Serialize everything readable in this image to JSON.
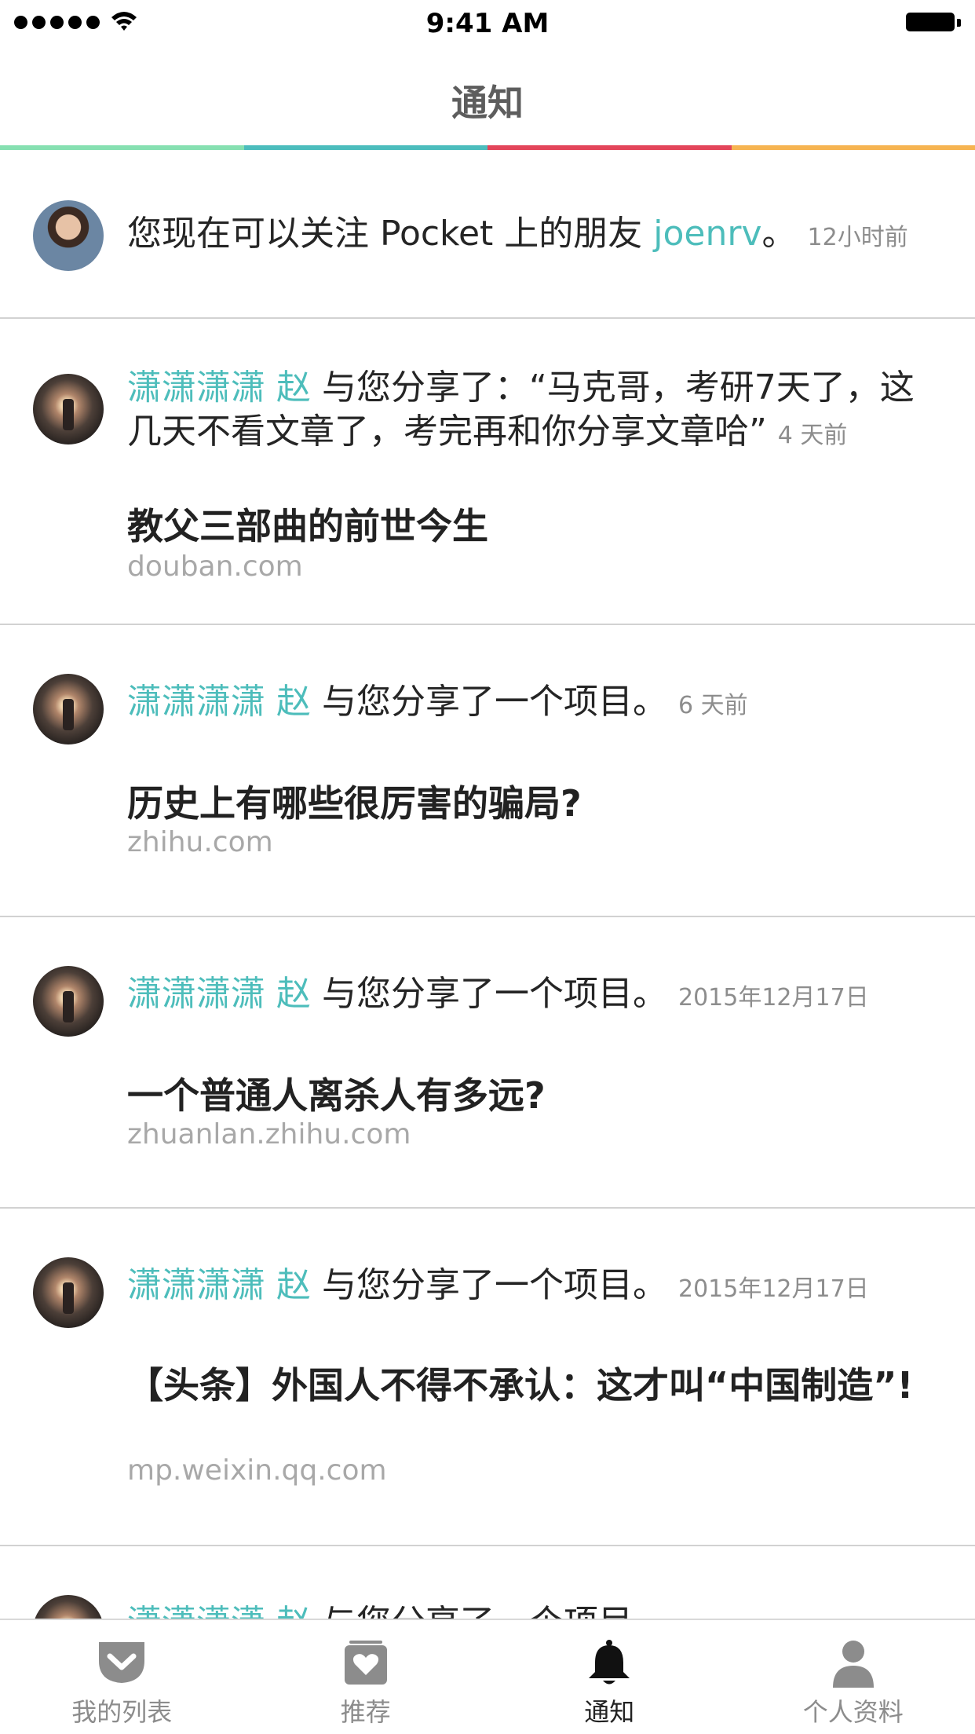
{
  "status_bar": {
    "time": "9:41 AM"
  },
  "nav": {
    "title": "通知"
  },
  "accent_colors": [
    "#86e0b1",
    "#4cbdbd",
    "#e3455a",
    "#f6b451"
  ],
  "notifications": [
    {
      "name": "",
      "prefix": "您现在可以关注 Pocket 上的朋友 ",
      "highlight": "joenrv",
      "suffix": "。",
      "time": "12小时前",
      "article_title": "",
      "article_domain": ""
    },
    {
      "name": "潇潇潇潇 赵",
      "prefix": " 与您分享了：“马克哥，考研7天了，这几天不看文章了，考完再和你分享文章哈”",
      "highlight": "",
      "suffix": "",
      "time": "4 天前",
      "article_title": "教父三部曲的前世今生",
      "article_domain": "douban.com"
    },
    {
      "name": "潇潇潇潇 赵",
      "prefix": " 与您分享了一个项目。",
      "highlight": "",
      "suffix": "",
      "time": "6 天前",
      "article_title": "历史上有哪些很厉害的骗局?",
      "article_domain": "zhihu.com"
    },
    {
      "name": "潇潇潇潇 赵",
      "prefix": " 与您分享了一个项目。",
      "highlight": "",
      "suffix": "",
      "time": "2015年12月17日",
      "article_title": "一个普通人离杀人有多远?",
      "article_domain": "zhuanlan.zhihu.com"
    },
    {
      "name": "潇潇潇潇 赵",
      "prefix": " 与您分享了一个项目。",
      "highlight": "",
      "suffix": "",
      "time": "2015年12月17日",
      "article_title": "【头条】外国人不得不承认：这才叫“中国制造”!",
      "article_domain": "mp.weixin.qq.com"
    },
    {
      "name": "潇潇潇潇 赵",
      "prefix": " 与您分享了一个项目。",
      "highlight": "",
      "suffix": "",
      "time": "",
      "article_title": "",
      "article_domain": ""
    }
  ],
  "tabs": [
    {
      "label": "我的列表",
      "icon": "pocket-icon",
      "active": false
    },
    {
      "label": "推荐",
      "icon": "recommend-heart-icon",
      "active": false
    },
    {
      "label": "通知",
      "icon": "bell-icon",
      "active": true
    },
    {
      "label": "个人资料",
      "icon": "profile-person-icon",
      "active": false
    }
  ]
}
